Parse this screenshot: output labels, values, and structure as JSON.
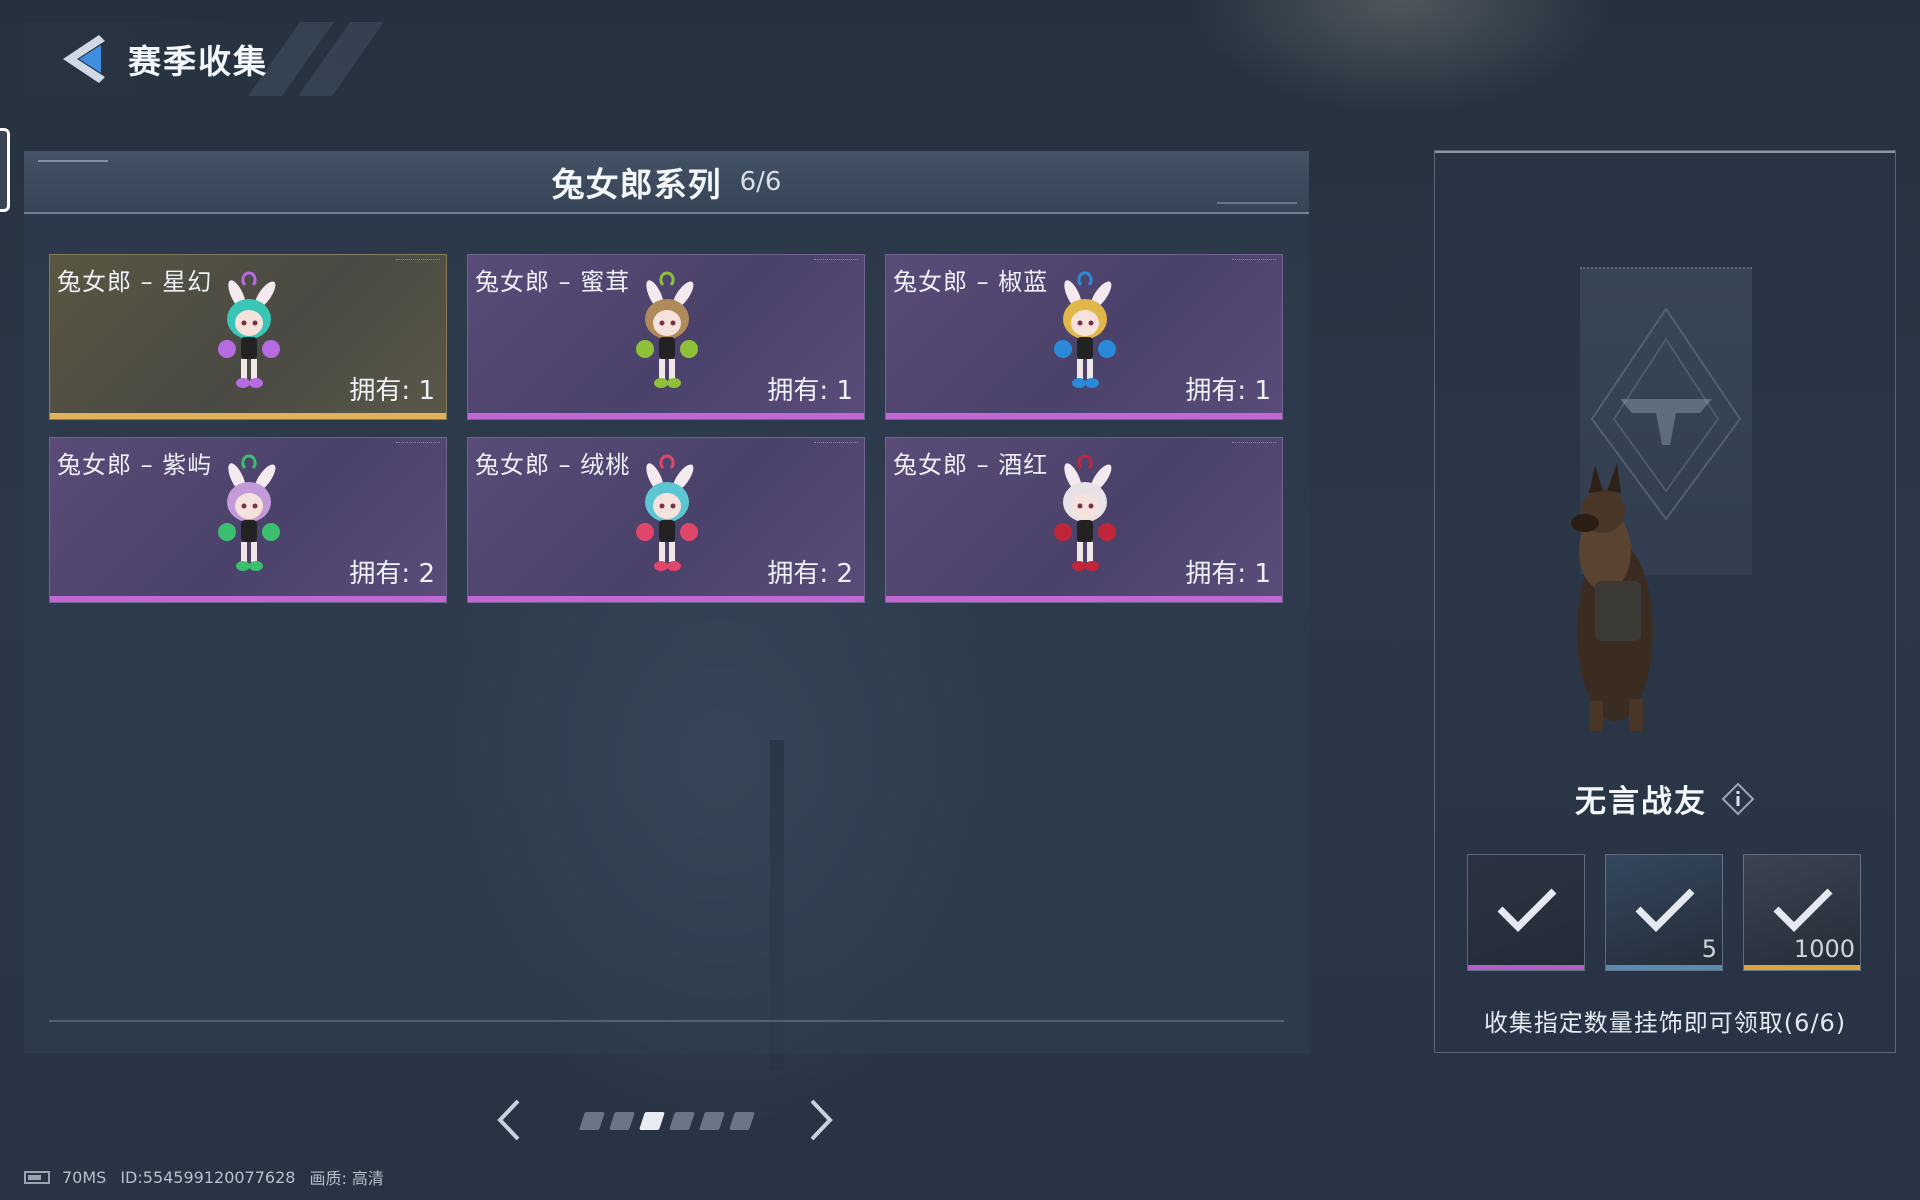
{
  "header": {
    "title": "赛季收集"
  },
  "series": {
    "title": "兔女郎系列",
    "progress": "6/6"
  },
  "cards": [
    {
      "name": "兔女郎 – 星幻",
      "owned": "拥有: 1",
      "rarity": "gold",
      "hair": "#39c6b6",
      "accent": "#b66be0"
    },
    {
      "name": "兔女郎 – 蜜茸",
      "owned": "拥有: 1",
      "rarity": "purple",
      "hair": "#b08a5a",
      "accent": "#8fc03a"
    },
    {
      "name": "兔女郎 – 椒蓝",
      "owned": "拥有: 1",
      "rarity": "purple",
      "hair": "#e0b84a",
      "accent": "#2b8ad8"
    },
    {
      "name": "兔女郎 – 紫屿",
      "owned": "拥有: 2",
      "rarity": "purple",
      "hair": "#c49ad8",
      "accent": "#3bbf6e"
    },
    {
      "name": "兔女郎 – 绒桃",
      "owned": "拥有: 2",
      "rarity": "purple",
      "hair": "#5cc6d4",
      "accent": "#e0466a"
    },
    {
      "name": "兔女郎 – 酒红",
      "owned": "拥有: 1",
      "rarity": "purple",
      "hair": "#e8e2e6",
      "accent": "#c0253a"
    }
  ],
  "pager": {
    "pages": 6,
    "current": 3
  },
  "reward": {
    "name": "无言战友",
    "description": "收集指定数量挂饰即可领取(6/6)",
    "items": [
      {
        "qty": "",
        "bar_color": "#b25fc8",
        "bg": "#2c3242",
        "claimed": true
      },
      {
        "qty": "5",
        "bar_color": "#5b8ab0",
        "bg": "#34485e",
        "claimed": true
      },
      {
        "qty": "1000",
        "bar_color": "#d9a540",
        "bg": "#3c4452",
        "claimed": true
      }
    ]
  },
  "status": {
    "latency": "70MS",
    "player_id": "ID:554599120077628",
    "quality": "画质:  高清"
  },
  "colors": {
    "gold_bar": "#e2b25a",
    "purple_bar": "#c268d6"
  }
}
